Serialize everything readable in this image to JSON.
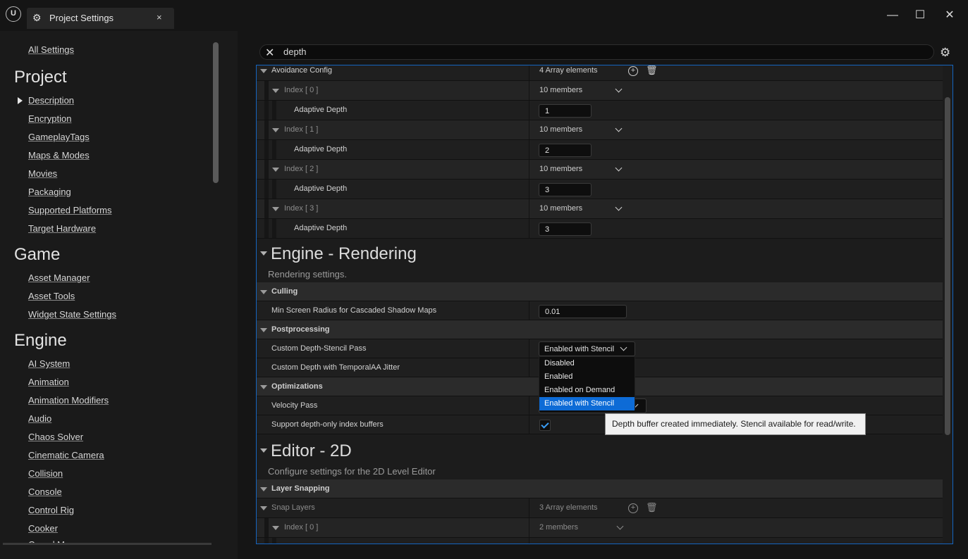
{
  "window": {
    "tab_title": "Project Settings",
    "tab_close": "×",
    "minimize": "—",
    "maximize": "☐",
    "close": "✕"
  },
  "sidebar": {
    "all_settings": "All Settings",
    "sections": [
      {
        "title": "Project",
        "items": [
          "Description",
          "Encryption",
          "GameplayTags",
          "Maps & Modes",
          "Movies",
          "Packaging",
          "Supported Platforms",
          "Target Hardware"
        ]
      },
      {
        "title": "Game",
        "items": [
          "Asset Manager",
          "Asset Tools",
          "Widget State Settings"
        ]
      },
      {
        "title": "Engine",
        "items": [
          "AI System",
          "Animation",
          "Animation Modifiers",
          "Audio",
          "Chaos Solver",
          "Cinematic Camera",
          "Collision",
          "Console",
          "Control Rig",
          "Cooker",
          "Crowd Manager"
        ]
      }
    ]
  },
  "search": {
    "value": "depth",
    "clear_icon": "✕"
  },
  "details": {
    "avoidance": {
      "label": "Avoidance Config",
      "count": "4 Array elements",
      "add_icon": "+",
      "delete_icon": "🗑",
      "indices": [
        {
          "label": "Index [ 0 ]",
          "members": "10 members",
          "prop": "Adaptive Depth",
          "value": "1"
        },
        {
          "label": "Index [ 1 ]",
          "members": "10 members",
          "prop": "Adaptive Depth",
          "value": "2"
        },
        {
          "label": "Index [ 2 ]",
          "members": "10 members",
          "prop": "Adaptive Depth",
          "value": "3"
        },
        {
          "label": "Index [ 3 ]",
          "members": "10 members",
          "prop": "Adaptive Depth",
          "value": "3"
        }
      ]
    },
    "rendering": {
      "title": "Engine - Rendering",
      "subtitle": "Rendering settings.",
      "culling": "Culling",
      "min_screen_radius_label": "Min Screen Radius for Cascaded Shadow Maps",
      "min_screen_radius_value": "0.01",
      "postprocessing": "Postprocessing",
      "custom_depth_label": "Custom Depth-Stencil Pass",
      "custom_depth_value": "Enabled with Stencil",
      "custom_depth_jitter_label": "Custom Depth with TemporalAA Jitter",
      "optimizations": "Optimizations",
      "velocity_label": "Velocity Pass",
      "depth_only_label": "Support depth-only index buffers"
    },
    "editor2d": {
      "title": "Editor - 2D",
      "subtitle": "Configure settings for the 2D Level Editor",
      "layer_snapping": "Layer Snapping",
      "snap_layers_label": "Snap Layers",
      "snap_layers_count": "3 Array elements",
      "index0_label": "Index [ 0 ]",
      "index0_members": "2 members"
    }
  },
  "dropdown": {
    "options": [
      "Disabled",
      "Enabled",
      "Enabled on Demand",
      "Enabled with Stencil"
    ],
    "selected": "Enabled with Stencil"
  },
  "tooltip": "Depth buffer created immediately. Stencil available for read/write."
}
